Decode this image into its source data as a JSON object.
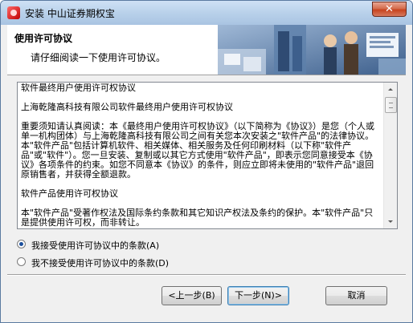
{
  "window": {
    "title": "安装 中山证券期权宝",
    "close_glyph": "✕"
  },
  "header": {
    "title": "使用许可协议",
    "subtitle": "请仔细阅读一下使用许可协议。"
  },
  "license": {
    "paragraphs": [
      "软件最终用户使用许可权协议",
      "上海乾隆高科技有限公司软件最终用户使用许可权协议",
      "重要须知请认真阅读：本《最终用户使用许可权协议》（以下简称为《协议》）是您（个人或单一机构团体）与上海乾隆高科技有限公司之间有关您本次安装之\"软件产品\"的法律协议。本\"软件产品\"包括计算机软件、相关媒体、相关服务及任何印刷材料（以下称\"软件产品\"或\"软件\"）。您一旦安装、复制或以其它方式使用\"软件产品\"，即表示您同意接受本《协议》各项条件的约束。如您不同意本《协议》的条件，则应立即将未使用的\"软件产品\"退回原销售者，并获得全额退款。",
      "软件产品使用许可权协议",
      "本\"软件产品\"受著作权法及国际条约条款和其它知识产权法及条约的保护。本\"软件产品\"只是提供使用许可权，而非转让。"
    ]
  },
  "options": {
    "accept": "我接受使用许可协议中的条款(A)",
    "decline": "我不接受使用许可协议中的条款(D)",
    "selected": "accept"
  },
  "buttons": {
    "back": "<上一步(B)",
    "next": "下一步(N)>",
    "cancel": "取消"
  }
}
